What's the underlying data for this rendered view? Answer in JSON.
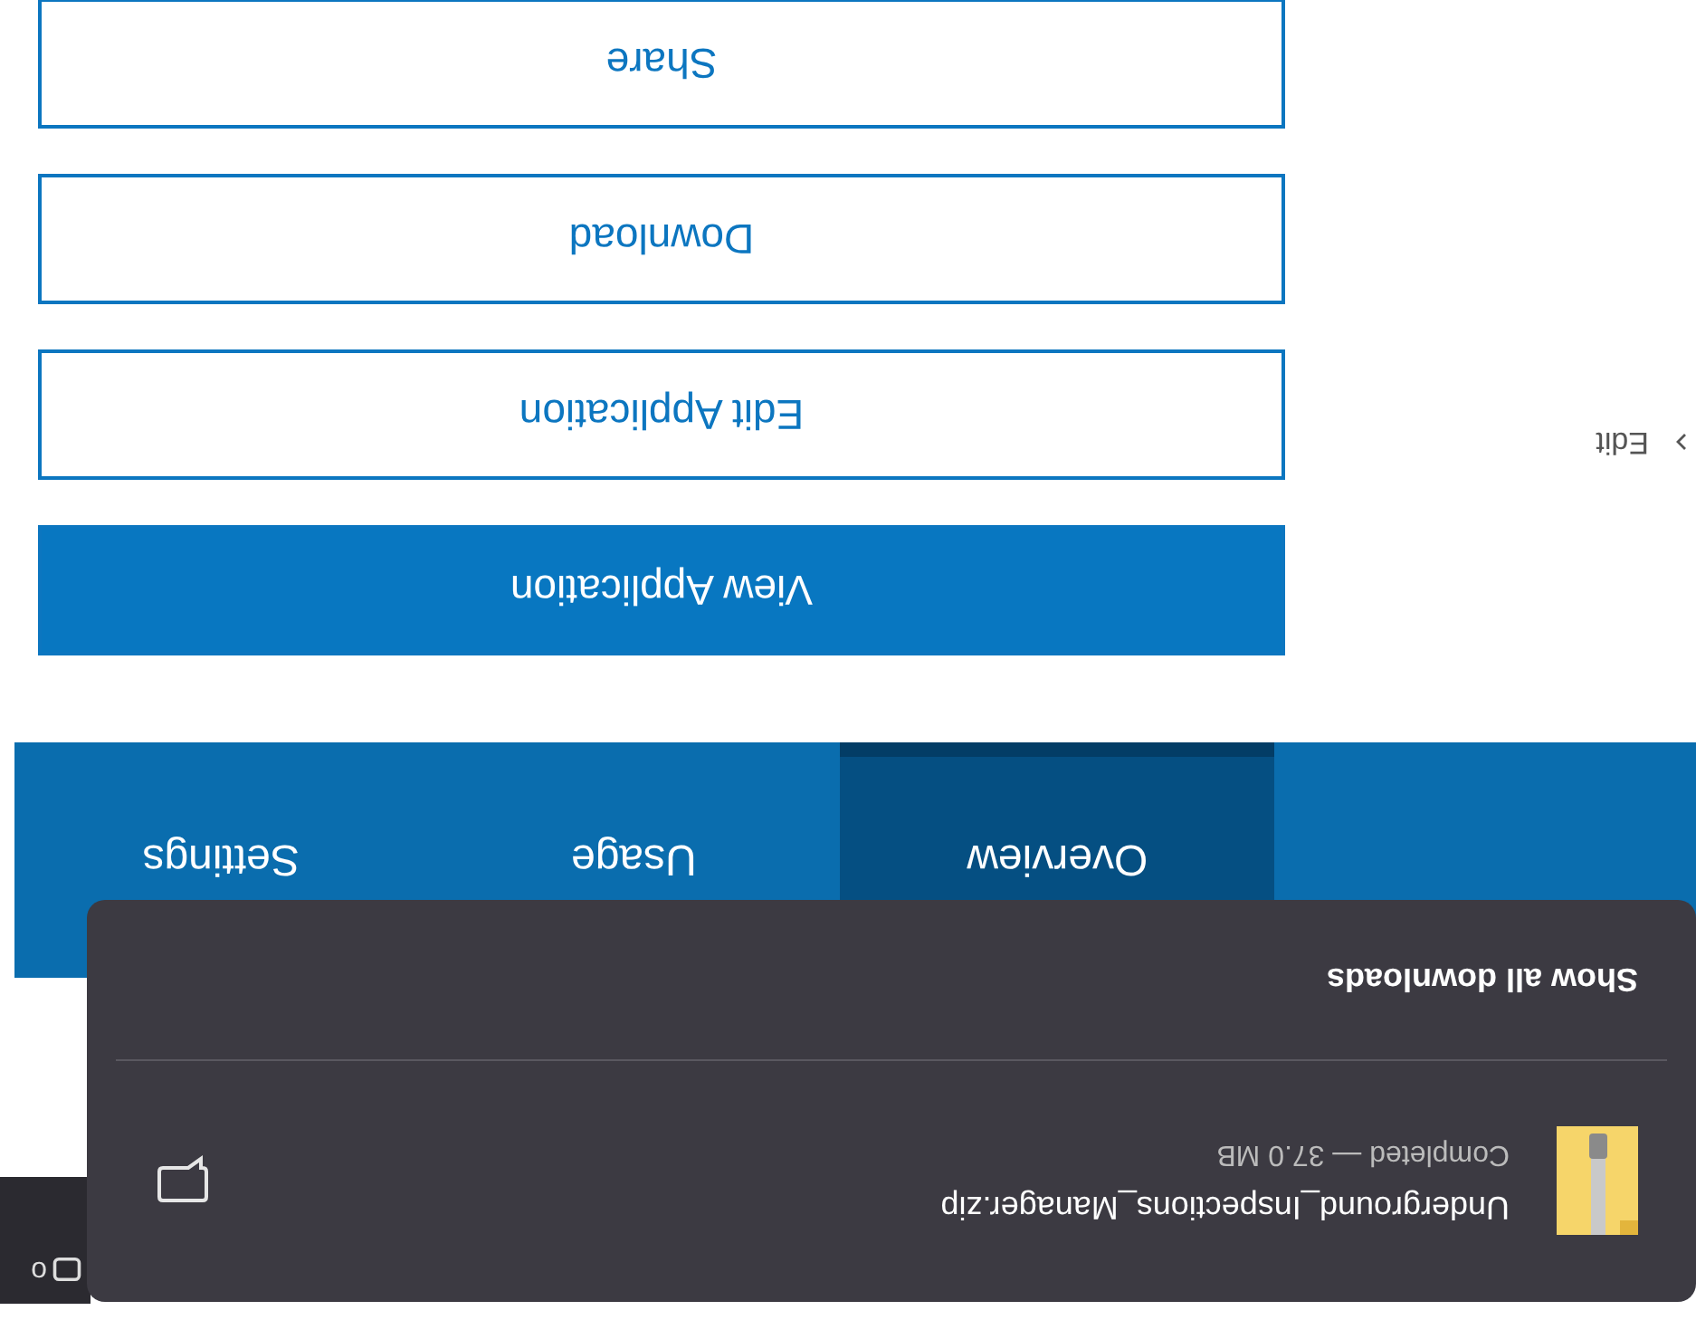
{
  "browser_strip": {
    "text": "o"
  },
  "nav_tabs": [
    {
      "label": "Overview",
      "selected": true
    },
    {
      "label": "Usage",
      "selected": false
    },
    {
      "label": "Settings",
      "selected": false
    }
  ],
  "breadcrumb": {
    "label": "Edit"
  },
  "actions": [
    {
      "label": "View Application",
      "primary": true
    },
    {
      "label": "Edit Application",
      "primary": false
    },
    {
      "label": "Download",
      "primary": false
    },
    {
      "label": "Share",
      "primary": false
    }
  ],
  "downloads_popup": {
    "file_name": "Underground_Inspections_Manager.zip",
    "status": "Completed — 37.0 MB",
    "show_all": "Show all downloads"
  }
}
